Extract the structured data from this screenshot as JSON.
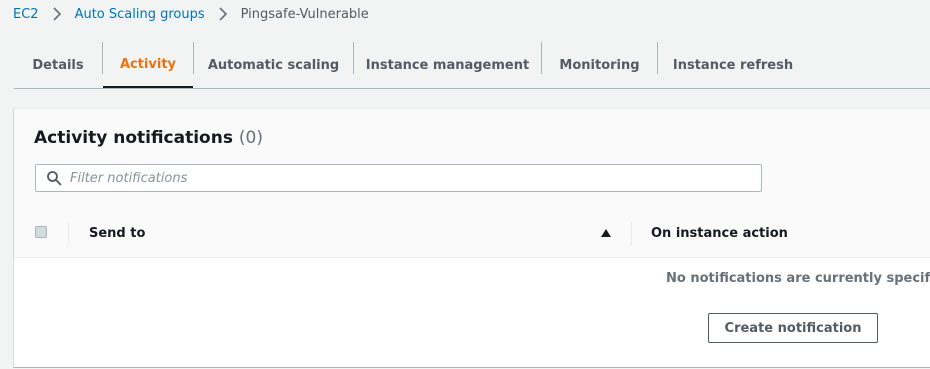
{
  "breadcrumb": {
    "items": [
      "EC2",
      "Auto Scaling groups",
      "Pingsafe-Vulnerable"
    ]
  },
  "tabs": [
    {
      "label": "Details",
      "active": false
    },
    {
      "label": "Activity",
      "active": true
    },
    {
      "label": "Automatic scaling",
      "active": false
    },
    {
      "label": "Instance management",
      "active": false
    },
    {
      "label": "Monitoring",
      "active": false
    },
    {
      "label": "Instance refresh",
      "active": false
    }
  ],
  "panel": {
    "title": "Activity notifications",
    "count": "(0)",
    "search_placeholder": "Filter notifications",
    "columns": [
      "Send to",
      "On instance action"
    ],
    "empty_message": "No notifications are currently specified",
    "create_button": "Create notification"
  },
  "colors": {
    "link": "#0073bb",
    "active_tab": "#ec7211",
    "text": "#16191f",
    "muted": "#545b64"
  },
  "icons": {
    "breadcrumb_separator": "chevron-right-icon",
    "search": "search-icon",
    "sort": "sort-ascending-icon"
  }
}
